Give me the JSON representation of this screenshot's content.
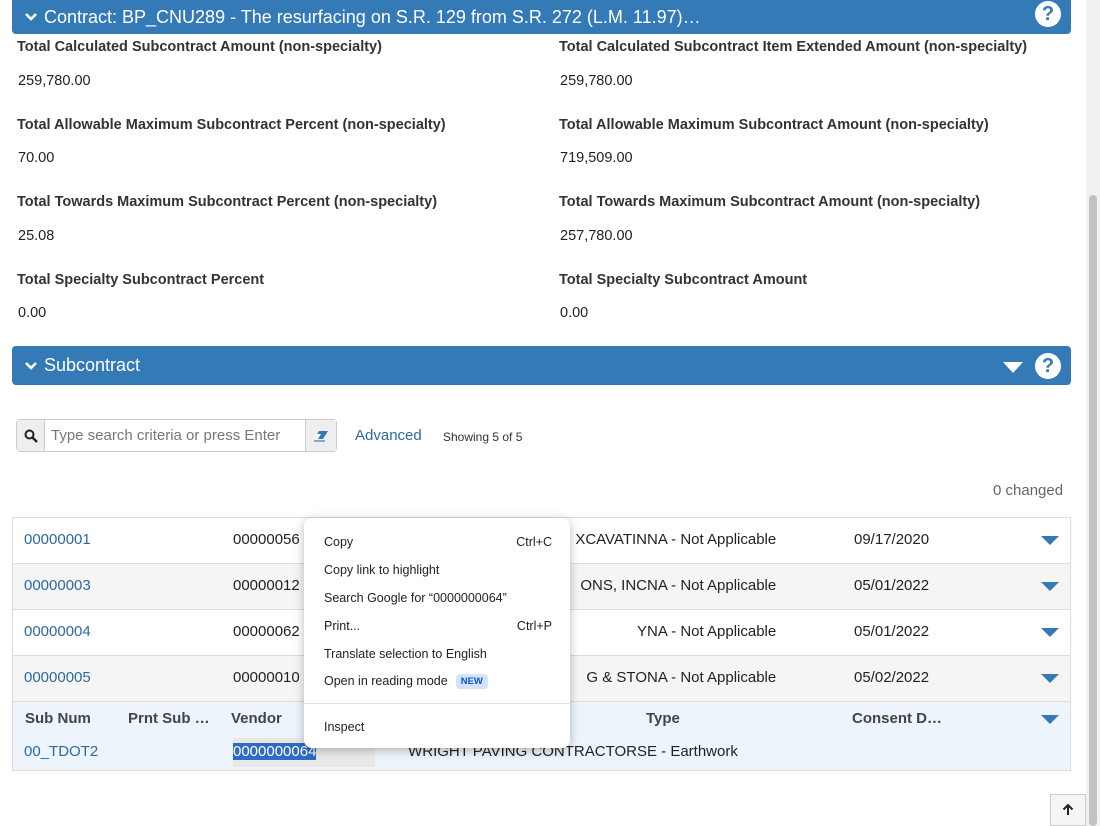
{
  "contract_header": {
    "title": "Contract: BP_CNU289 - The resurfacing on S.R. 129 from S.R. 272 (L.M. 11.97)…",
    "help": "?"
  },
  "summary": {
    "calc_amount_label": "Total Calculated Subcontract Amount (non-specialty)",
    "calc_amount_value": "259,780.00",
    "calc_item_label": "Total Calculated Subcontract Item Extended Amount (non-specialty)",
    "calc_item_value": "259,780.00",
    "allow_pct_label": "Total Allowable Maximum Subcontract Percent (non-specialty)",
    "allow_pct_value": "70.00",
    "allow_amt_label": "Total Allowable Maximum Subcontract Amount (non-specialty)",
    "allow_amt_value": "719,509.00",
    "toward_pct_label": "Total Towards Maximum Subcontract Percent (non-specialty)",
    "toward_pct_value": "25.08",
    "toward_amt_label": "Total Towards Maximum Subcontract Amount (non-specialty)",
    "toward_amt_value": "257,780.00",
    "spec_pct_label": "Total Specialty Subcontract Percent",
    "spec_pct_value": "0.00",
    "spec_amt_label": "Total Specialty Subcontract Amount",
    "spec_amt_value": "0.00"
  },
  "subcontract_header": {
    "title": "Subcontract",
    "help": "?"
  },
  "search": {
    "placeholder": "Type search criteria or press Enter",
    "advanced": "Advanced",
    "showing": "Showing 5 of 5",
    "changed": "0 changed"
  },
  "rows": [
    {
      "sub": "00000001",
      "vendor": "00000056",
      "name": "XCAVATIN",
      "type": "NA - Not Applicable",
      "date": "09/17/2020"
    },
    {
      "sub": "00000003",
      "vendor": "00000012",
      "name": "ONS, INC",
      "type": "NA - Not Applicable",
      "date": "05/01/2022"
    },
    {
      "sub": "00000004",
      "vendor": "00000062",
      "name": "Y",
      "type": "NA - Not Applicable",
      "date": "05/01/2022"
    },
    {
      "sub": "00000005",
      "vendor": "00000010",
      "name": "G & STO",
      "type": "NA - Not Applicable",
      "date": "05/02/2022"
    }
  ],
  "columns": {
    "sub_num": "Sub Num",
    "prnt_sub": "Prnt Sub …",
    "vendor": "Vendor",
    "type": "Type",
    "consent": "Consent D…"
  },
  "edit_row": {
    "sub": "00_TDOT2",
    "vendor": "0000000064",
    "name": "WRIGHT PAVING CONTRACTORS",
    "type": "E - Earthwork"
  },
  "context_menu": {
    "copy": "Copy",
    "copy_shortcut": "Ctrl+C",
    "copy_link": "Copy link to highlight",
    "search_google": "Search Google for “0000000064”",
    "print": "Print...",
    "print_shortcut": "Ctrl+P",
    "translate": "Translate selection to English",
    "reading_mode": "Open in reading mode",
    "new_badge": "NEW",
    "inspect": "Inspect"
  },
  "colors": {
    "accent": "#337ab7",
    "link": "#2a6aa0",
    "selection": "#2e6bc6"
  }
}
